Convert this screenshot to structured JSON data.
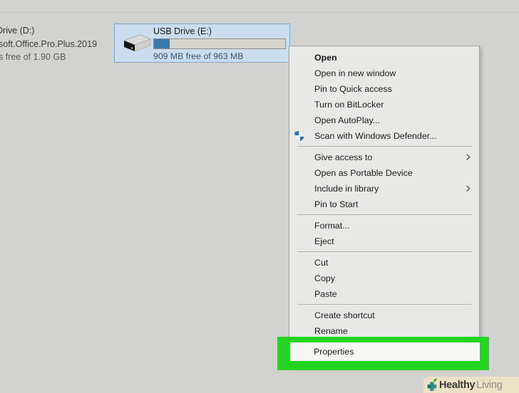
{
  "left_drive_item": {
    "name_line": "Drive (D:)",
    "label_line": "soft.Office.Pro.Plus.2019",
    "free_line": "s free of 1.90 GB"
  },
  "usb_drive_tile": {
    "title": "USB Drive (E:)",
    "free_text": "909 MB free of 963 MB",
    "capacity_percent_used": 12,
    "selection_bg": "#c9ddef",
    "selection_border": "#79a8cc",
    "bar_fill_color": "#3779ab"
  },
  "context_menu": {
    "bg_color": "#e8e8e6",
    "border_color": "#9f9f9d",
    "groups": [
      {
        "items": [
          {
            "label": "Open",
            "bold": true
          },
          {
            "label": "Open in new window"
          },
          {
            "label": "Pin to Quick access"
          },
          {
            "label": "Turn on BitLocker"
          },
          {
            "label": "Open AutoPlay..."
          },
          {
            "label": "Scan with Windows Defender...",
            "icon": "defender-shield"
          }
        ]
      },
      {
        "items": [
          {
            "label": "Give access to",
            "submenu": true
          },
          {
            "label": "Open as Portable Device"
          },
          {
            "label": "Include in library",
            "submenu": true
          },
          {
            "label": "Pin to Start"
          }
        ]
      },
      {
        "items": [
          {
            "label": "Format..."
          },
          {
            "label": "Eject"
          }
        ]
      },
      {
        "items": [
          {
            "label": "Cut"
          },
          {
            "label": "Copy"
          },
          {
            "label": "Paste"
          }
        ]
      },
      {
        "items": [
          {
            "label": "Create shortcut"
          },
          {
            "label": "Rename"
          }
        ]
      },
      {
        "items": [
          {
            "label": "Properties",
            "highlighted": true
          }
        ]
      }
    ]
  },
  "highlight_box": {
    "color": "#23d423"
  },
  "watermark": {
    "brand_bold": "Healthy",
    "brand_light": "Living",
    "bg_color": "#ebe1c6",
    "icon": "medical-cross-leaf-icon"
  }
}
